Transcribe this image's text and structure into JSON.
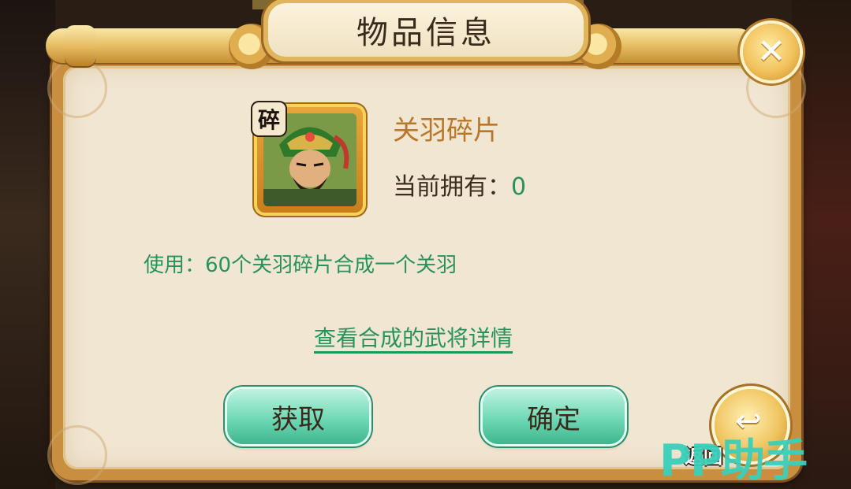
{
  "dialog": {
    "title": "物品信息",
    "close_icon": "close-icon"
  },
  "item": {
    "badge": "碎",
    "name": "关羽碎片",
    "owned_label": "当前拥有：",
    "owned_count": "0",
    "usage_label": "使用：",
    "usage_text": "60个关羽碎片合成一个关羽"
  },
  "link": {
    "view_details": "查看合成的武将详情"
  },
  "buttons": {
    "get": "获取",
    "confirm": "确定",
    "back": "返回"
  },
  "watermark": "PP助手",
  "colors": {
    "accent_green": "#27935c",
    "name_gold": "#b9772b",
    "frame_gold": "#e1b55c",
    "button_green": "#6fd8b5"
  }
}
